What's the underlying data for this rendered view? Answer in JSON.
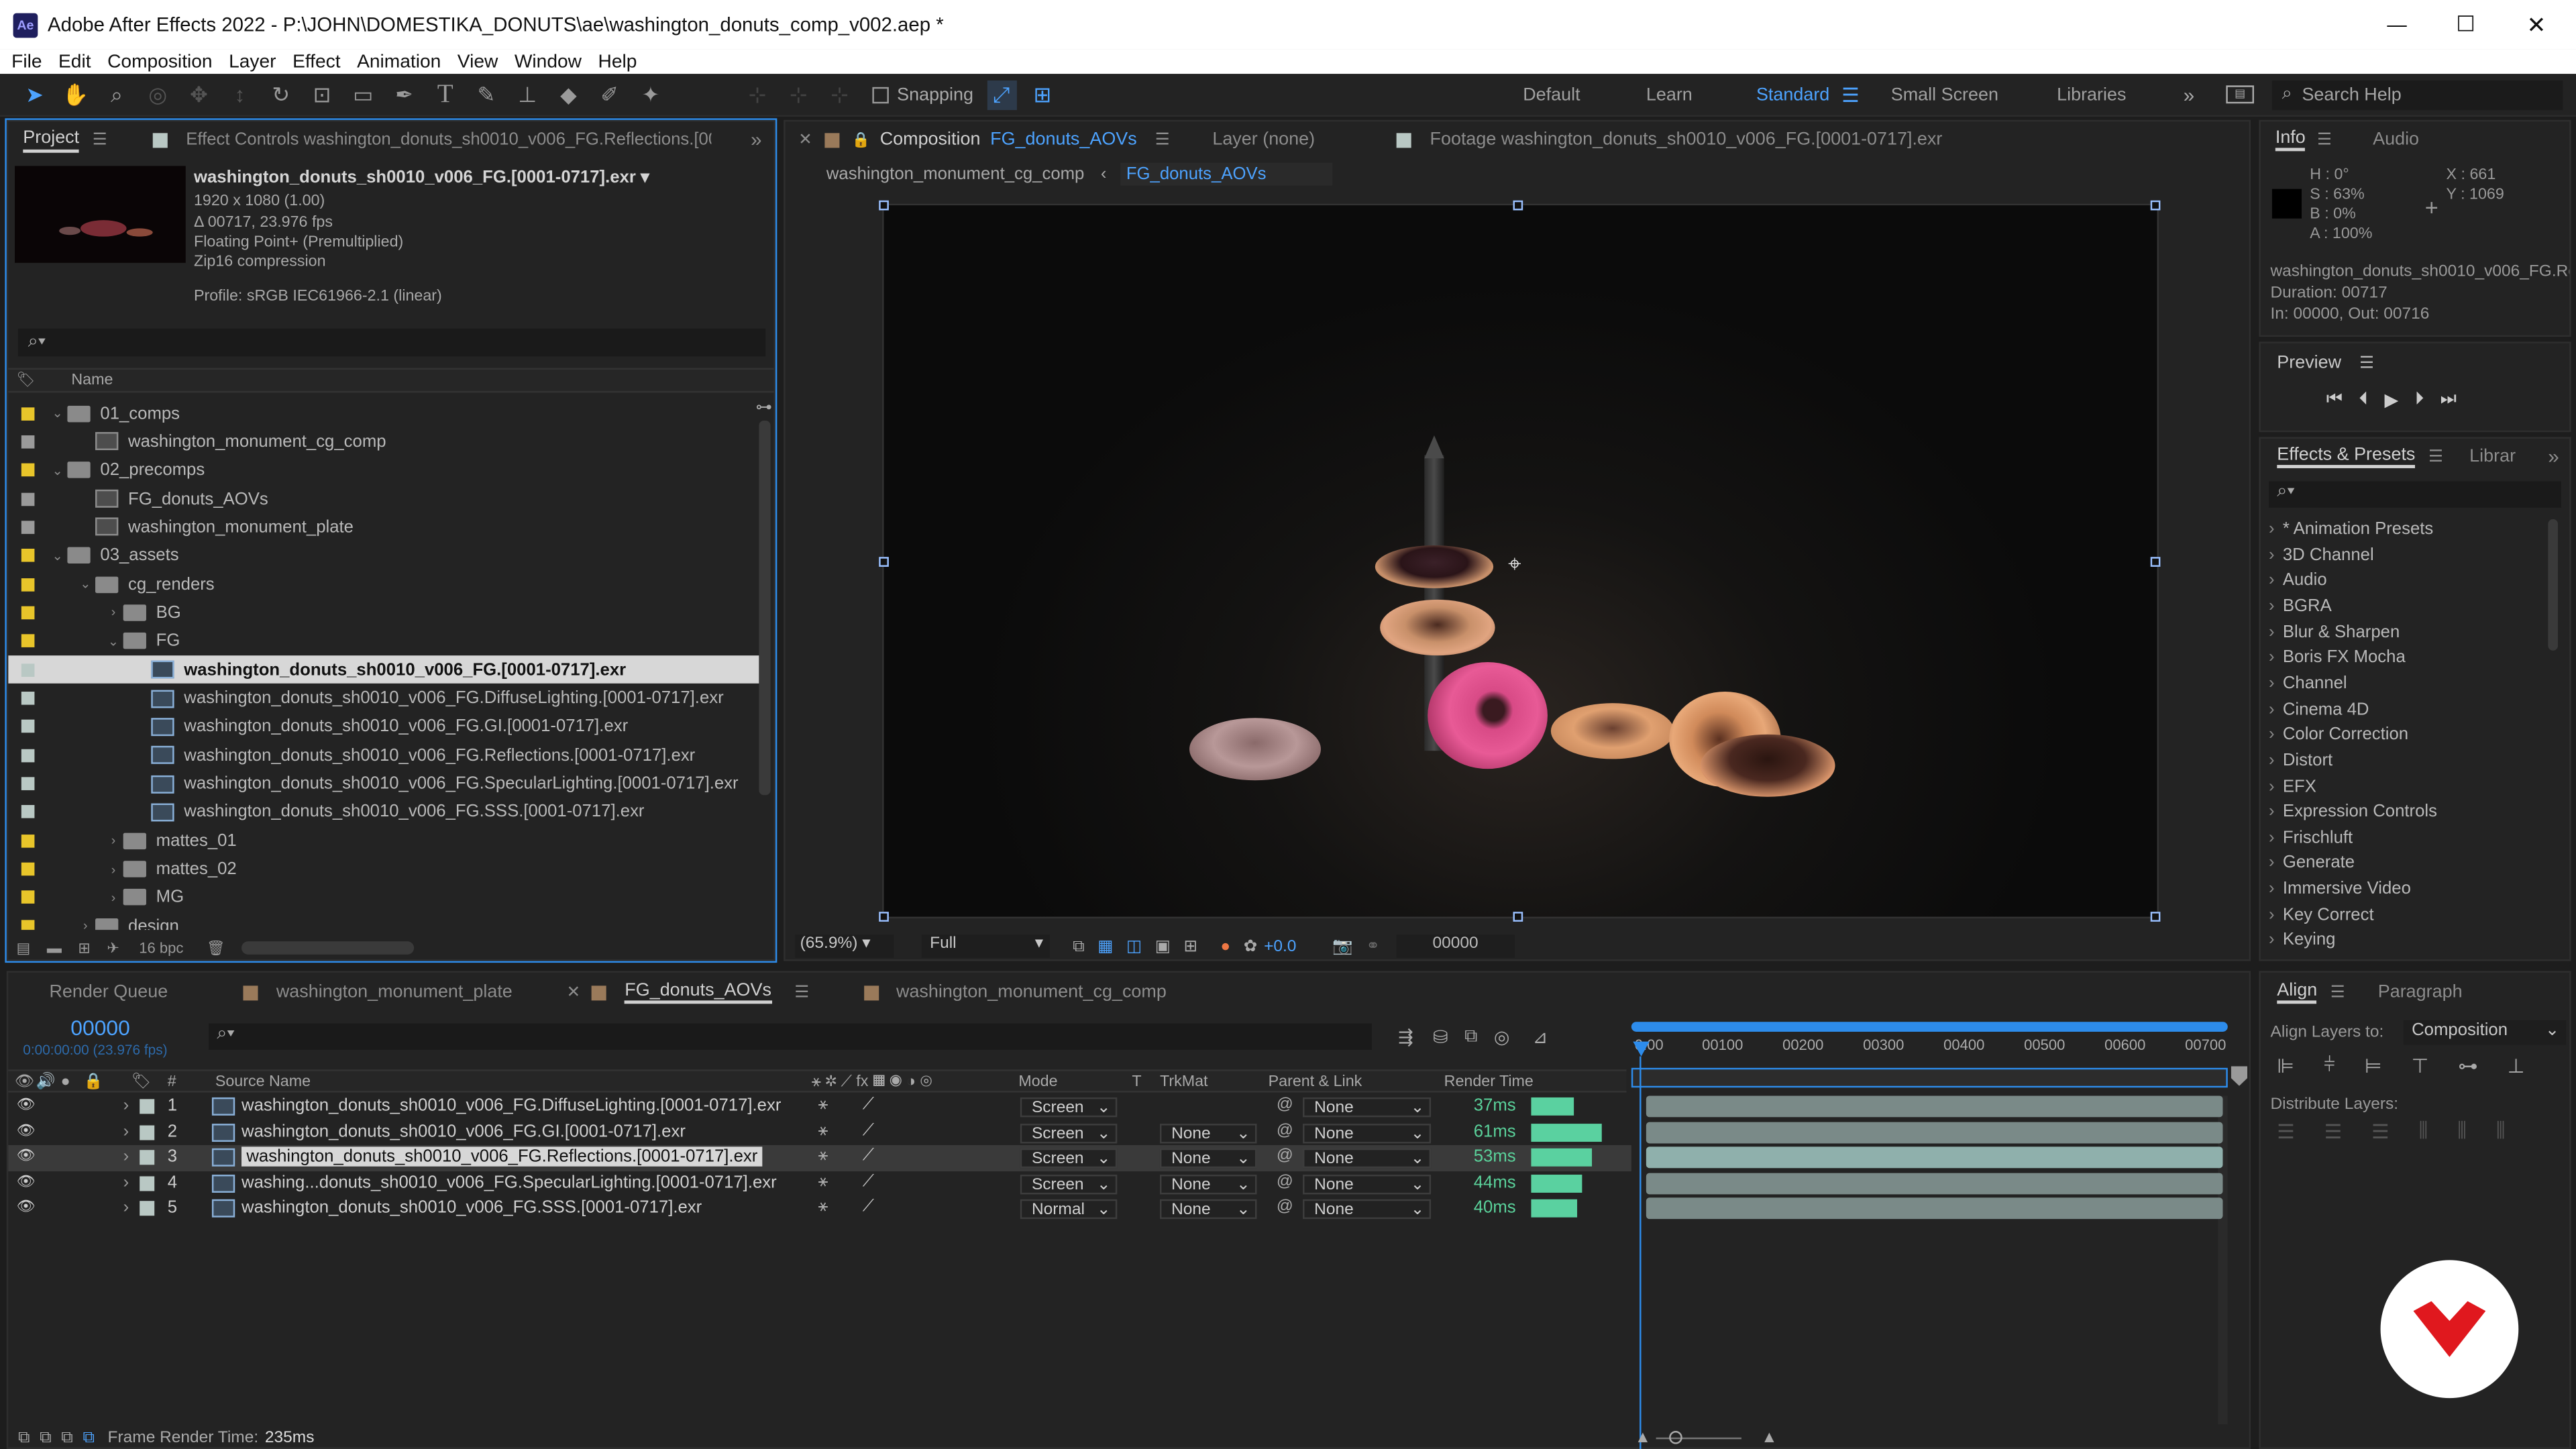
{
  "titlebar": {
    "app_icon": "Ae",
    "title": "Adobe After Effects 2022 - P:\\JOHN\\DOMESTIKA_DONUTS\\ae\\washington_donuts_comp_v002.aep *",
    "min": "—",
    "max": "☐",
    "close": "✕"
  },
  "menu": [
    "File",
    "Edit",
    "Composition",
    "Layer",
    "Effect",
    "Animation",
    "View",
    "Window",
    "Help"
  ],
  "toolbar": {
    "snapping": "Snapping",
    "workspaces": [
      "Default",
      "Learn",
      "Standard",
      "Small Screen",
      "Libraries"
    ],
    "active_workspace": "Standard",
    "search_placeholder": "Search Help"
  },
  "project": {
    "tab": "Project",
    "effect_controls": "Effect Controls washington_donuts_sh0010_v006_FG.Reflections.[000",
    "footage_name": "washington_donuts_sh0010_v006_FG.[0001-0717].exr ▾",
    "meta": [
      "1920 x 1080 (1.00)",
      "Δ 00717, 23.976 fps",
      "Floating Point+ (Premultiplied)",
      "Zip16 compression"
    ],
    "profile": "Profile: sRGB IEC61966-2.1 (linear)",
    "col_name": "Name",
    "tree": [
      {
        "label": "01_comps",
        "type": "folder",
        "depth": 0,
        "open": true,
        "color": "#e8c52a"
      },
      {
        "label": "washington_monument_cg_comp",
        "type": "comp",
        "depth": 1,
        "color": "#9a9a9a"
      },
      {
        "label": "02_precomps",
        "type": "folder",
        "depth": 0,
        "open": true,
        "color": "#e8c52a"
      },
      {
        "label": "FG_donuts_AOVs",
        "type": "comp",
        "depth": 1,
        "color": "#9a9a9a"
      },
      {
        "label": "washington_monument_plate",
        "type": "comp",
        "depth": 1,
        "color": "#9a9a9a"
      },
      {
        "label": "03_assets",
        "type": "folder",
        "depth": 0,
        "open": true,
        "color": "#e8c52a"
      },
      {
        "label": "cg_renders",
        "type": "folder",
        "depth": 1,
        "open": true,
        "color": "#e8c52a"
      },
      {
        "label": "BG",
        "type": "folder",
        "depth": 2,
        "open": false,
        "color": "#e8c52a"
      },
      {
        "label": "FG",
        "type": "folder",
        "depth": 2,
        "open": true,
        "color": "#e8c52a"
      },
      {
        "label": "washington_donuts_sh0010_v006_FG.[0001-0717].exr",
        "type": "seq",
        "depth": 3,
        "selected": true,
        "color": "#b9c8c4"
      },
      {
        "label": "washington_donuts_sh0010_v006_FG.DiffuseLighting.[0001-0717].exr",
        "type": "seq",
        "depth": 3,
        "color": "#b9c8c4"
      },
      {
        "label": "washington_donuts_sh0010_v006_FG.GI.[0001-0717].exr",
        "type": "seq",
        "depth": 3,
        "color": "#b9c8c4"
      },
      {
        "label": "washington_donuts_sh0010_v006_FG.Reflections.[0001-0717].exr",
        "type": "seq",
        "depth": 3,
        "color": "#b9c8c4"
      },
      {
        "label": "washington_donuts_sh0010_v006_FG.SpecularLighting.[0001-0717].exr",
        "type": "seq",
        "depth": 3,
        "color": "#b9c8c4"
      },
      {
        "label": "washington_donuts_sh0010_v006_FG.SSS.[0001-0717].exr",
        "type": "seq",
        "depth": 3,
        "color": "#b9c8c4"
      },
      {
        "label": "mattes_01",
        "type": "folder",
        "depth": 2,
        "open": false,
        "color": "#e8c52a"
      },
      {
        "label": "mattes_02",
        "type": "folder",
        "depth": 2,
        "open": false,
        "color": "#e8c52a"
      },
      {
        "label": "MG",
        "type": "folder",
        "depth": 2,
        "open": false,
        "color": "#e8c52a"
      },
      {
        "label": "design",
        "type": "folder",
        "depth": 1,
        "open": false,
        "color": "#e8c52a"
      }
    ],
    "bpc": "16 bpc"
  },
  "viewer": {
    "comp_tab": "Composition",
    "comp_name": "FG_donuts_AOVs",
    "layer_tab": "Layer  (none)",
    "footage_tab": "Footage  washington_donuts_sh0010_v006_FG.[0001-0717].exr",
    "crumb1": "washington_monument_cg_comp",
    "crumb2": "FG_donuts_AOVs",
    "zoom": "(65.9%)",
    "resolution": "Full",
    "exposure": "+0.0",
    "timecode": "00000"
  },
  "info": {
    "tab": "Info",
    "audio_tab": "Audio",
    "h": "H :  0°",
    "s": "S :  63%",
    "b": "B :  0%",
    "a": "A :  100%",
    "x": "X : 661",
    "y": "Y : 1069",
    "file": "washington_donuts_sh0010_v006_FG.Re",
    "duration": "Duration: 00717",
    "inout": "In: 00000, Out: 00716"
  },
  "preview": {
    "title": "Preview"
  },
  "effects": {
    "tab": "Effects & Presets",
    "lib_tab": "Librar",
    "items": [
      "* Animation Presets",
      "3D Channel",
      "Audio",
      "BGRA",
      "Blur & Sharpen",
      "Boris FX Mocha",
      "Channel",
      "Cinema 4D",
      "Color Correction",
      "Distort",
      "EFX",
      "Expression Controls",
      "Frischluft",
      "Generate",
      "Immersive Video",
      "Key Correct",
      "Keying"
    ]
  },
  "timeline": {
    "tabs": [
      "Render Queue",
      "washington_monument_plate",
      "FG_donuts_AOVs",
      "washington_monument_cg_comp"
    ],
    "timecode": "00000",
    "timecode_sub": "0:00:00:00 (23.976 fps)",
    "headers": {
      "source": "Source Name",
      "mode": "Mode",
      "t": "T",
      "trkmat": "TrkMat",
      "parent": "Parent & Link",
      "render": "Render Time"
    },
    "ruler": [
      "00100",
      "00200",
      "00300",
      "00400",
      "00500",
      "00600",
      "00700"
    ],
    "ruler_start": "0:00",
    "layers": [
      {
        "num": "1",
        "name": "washington_donuts_sh0010_v006_FG.DiffuseLighting.[0001-0717].exr",
        "mode": "Screen",
        "trkmat": "",
        "parent": "None",
        "render": "37ms",
        "bar": 0.37
      },
      {
        "num": "2",
        "name": "washington_donuts_sh0010_v006_FG.GI.[0001-0717].exr",
        "mode": "Screen",
        "trkmat": "None",
        "parent": "None",
        "render": "61ms",
        "bar": 0.61
      },
      {
        "num": "3",
        "name": "washington_donuts_sh0010_v006_FG.Reflections.[0001-0717].exr",
        "mode": "Screen",
        "trkmat": "None",
        "parent": "None",
        "render": "53ms",
        "bar": 0.53,
        "selected": true
      },
      {
        "num": "4",
        "name": "washing...donuts_sh0010_v006_FG.SpecularLighting.[0001-0717].exr",
        "mode": "Screen",
        "trkmat": "None",
        "parent": "None",
        "render": "44ms",
        "bar": 0.44
      },
      {
        "num": "5",
        "name": "washington_donuts_sh0010_v006_FG.SSS.[0001-0717].exr",
        "mode": "Normal",
        "trkmat": "None",
        "parent": "None",
        "render": "40ms",
        "bar": 0.4
      }
    ],
    "frame_render": "Frame Render Time:",
    "frame_render_val": "235ms"
  },
  "align": {
    "tab": "Align",
    "para_tab": "Paragraph",
    "align_to": "Align Layers to:",
    "align_to_val": "Composition",
    "distribute": "Distribute Layers:"
  }
}
